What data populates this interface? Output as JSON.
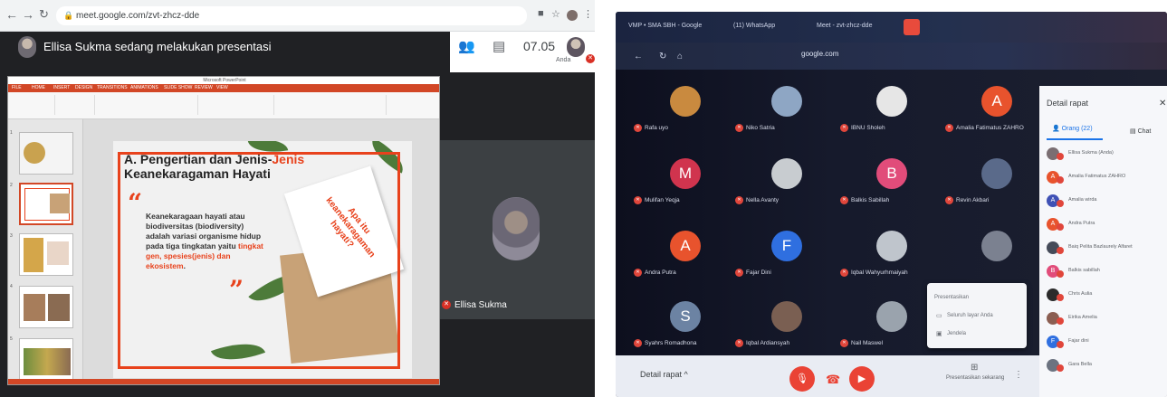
{
  "left": {
    "browser": {
      "url": "meet.google.com/zvt-zhcz-dde"
    },
    "meet": {
      "presenting_text": "Ellisa Sukma sedang melakukan presentasi",
      "clock": "07.05",
      "self_label": "Anda",
      "tile_name": "Ellisa Sukma"
    },
    "slide": {
      "title_part1": "A. Pengertian dan Jenis-",
      "title_part2": "Jenis",
      "title_part3": "Keanekaragaman",
      "title_part4": " Hayati",
      "body_1": "Keanekaragaan hayati atau biodiversitas (biodiversity) adalah variasi organisme hidup pada tiga tingkatan yaitu ",
      "body_hl1": "tingkat gen, spesies(jenis) dan ekosistem",
      "body_end": ".",
      "card_text": "Apa itu keanekaragaman hayati?"
    },
    "ppt_tabs": [
      "FILE",
      "HOME",
      "INSERT",
      "DESIGN",
      "TRANSITIONS",
      "ANIMATIONS",
      "SLIDE SHOW",
      "REVIEW",
      "VIEW"
    ]
  },
  "right": {
    "tabs": [
      "VMP • SMA SBH - Google",
      "(11) WhatsApp",
      "Meet - zvt-zhcz-dde"
    ],
    "url": "google.com",
    "participants": [
      {
        "name": "Rafa uyo",
        "initial": "",
        "color": "#c98a3f"
      },
      {
        "name": "Niko Satria",
        "initial": "",
        "color": "#8ea6c4"
      },
      {
        "name": "IBNU Sholeh",
        "initial": "",
        "color": "#e6e6e6"
      },
      {
        "name": "Amalia Fatimatus ZAHRO",
        "initial": "A",
        "color": "#e8532d"
      },
      {
        "name": "Mulifan Yeqja",
        "initial": "M",
        "color": "#d0344e"
      },
      {
        "name": "Nella Avanty",
        "initial": "",
        "color": "#c8ccd0"
      },
      {
        "name": "Balkis Sabillah",
        "initial": "B",
        "color": "#e14c7a"
      },
      {
        "name": "Revin Akbari",
        "initial": "",
        "color": "#5a6a8a"
      },
      {
        "name": "Andra Putra",
        "initial": "A",
        "color": "#e8532d"
      },
      {
        "name": "Fajar Dini",
        "initial": "F",
        "color": "#2f6fe0"
      },
      {
        "name": "Iqbal Wahyurhmaiyah",
        "initial": "",
        "color": "#bfc5cc"
      },
      {
        "name": "",
        "initial": "",
        "color": "#7b8190"
      },
      {
        "name": "Syahrs Romadhona",
        "initial": "S",
        "color": "#6c83a3"
      },
      {
        "name": "Iqbal Ardiansyah",
        "initial": "",
        "color": "#7a5f52"
      },
      {
        "name": "Nail Maswel",
        "initial": "",
        "color": "#9aa3ad"
      }
    ],
    "bottom": {
      "details": "Detail rapat",
      "present": "Presentasikan sekarang"
    },
    "popup": {
      "title": "Presentasikan",
      "option1": "Seluruh layar Anda",
      "option2": "Jendela"
    },
    "side": {
      "title": "Detail rapat",
      "tab_people": "Orang (22)",
      "tab_chat": "Chat",
      "people": [
        {
          "name": "Ellisa Sukma (Anda)",
          "initial": "",
          "color": "#7a6e72"
        },
        {
          "name": "Amalia Fatimatus ZAHRO",
          "initial": "A",
          "color": "#e8532d"
        },
        {
          "name": "Amalia wirda",
          "initial": "A",
          "color": "#3f51b5"
        },
        {
          "name": "Andra Putra",
          "initial": "A",
          "color": "#e8532d"
        },
        {
          "name": "Baiq Pelita Bazlaurely Alfaret",
          "initial": "",
          "color": "#454b59"
        },
        {
          "name": "Balkis sabillah",
          "initial": "B",
          "color": "#e14c7a"
        },
        {
          "name": "Chris Aulia",
          "initial": "",
          "color": "#2b2b2b"
        },
        {
          "name": "Eirika Amelia",
          "initial": "",
          "color": "#8b5e52"
        },
        {
          "name": "Fajar dini",
          "initial": "F",
          "color": "#2f6fe0"
        },
        {
          "name": "Gara Bella",
          "initial": "",
          "color": "#6c7380"
        }
      ]
    }
  }
}
